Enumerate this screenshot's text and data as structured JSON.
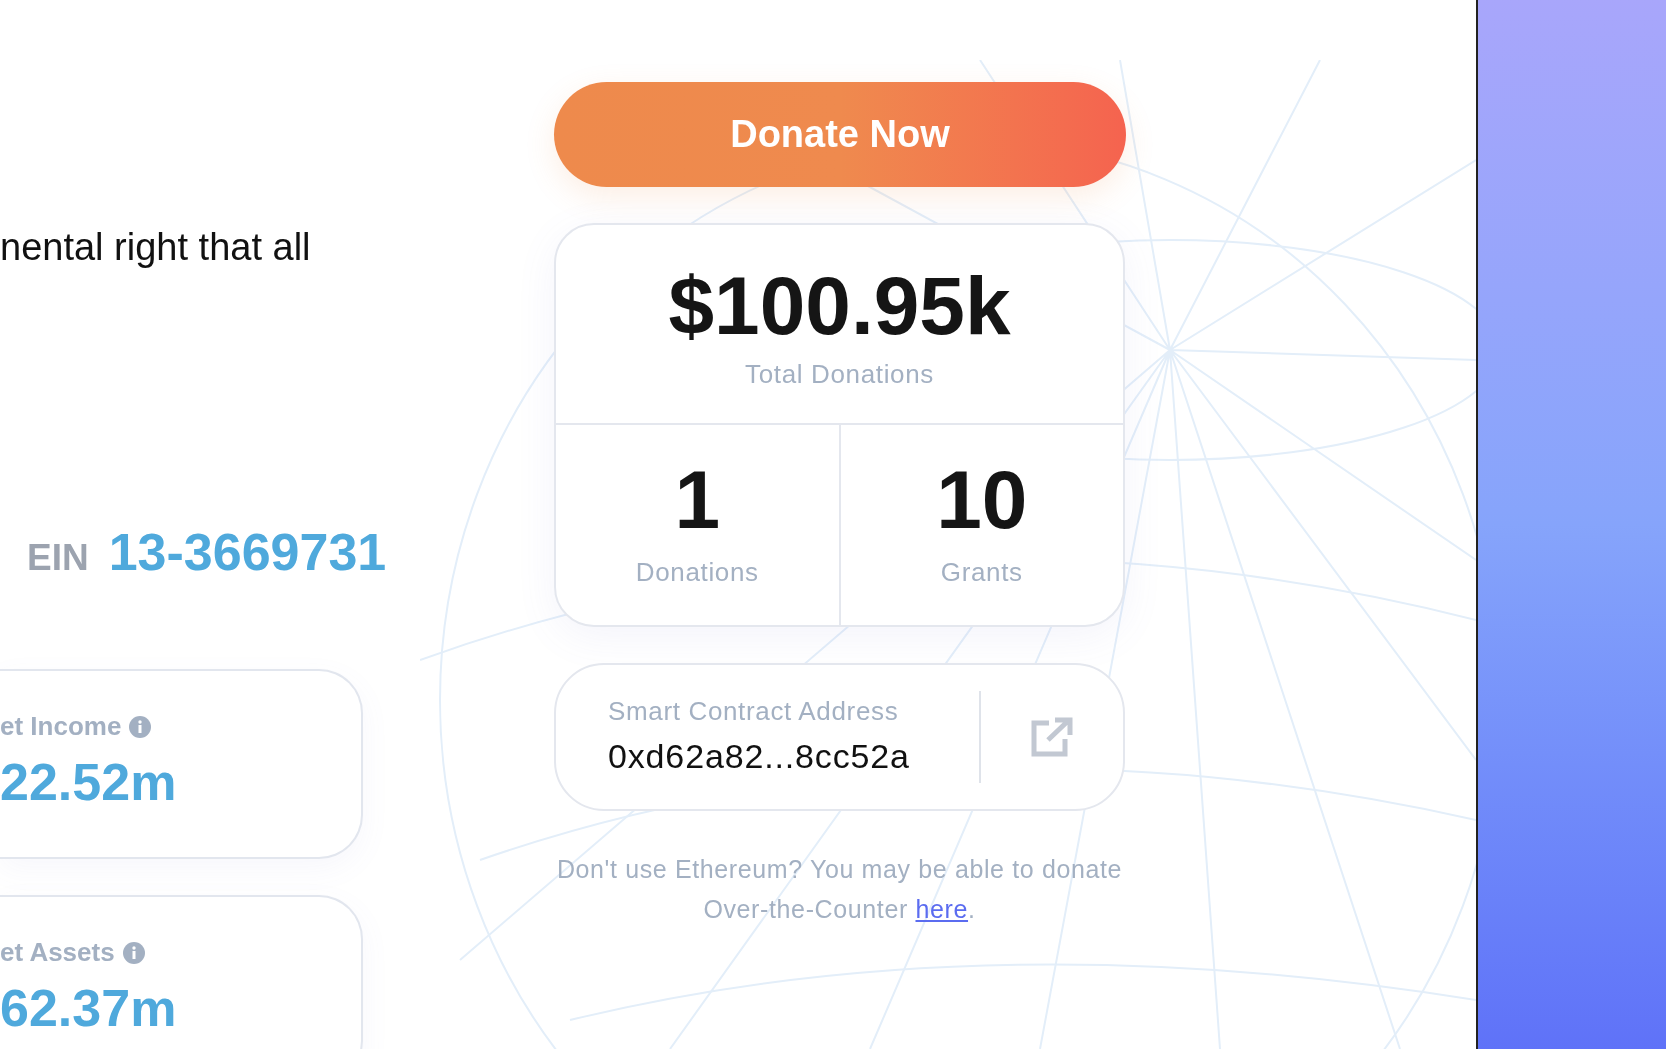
{
  "mission_text": "nental right that all",
  "ein": {
    "label": "EIN",
    "value": "13-3669731"
  },
  "metric_cards": [
    {
      "label": "et Income",
      "value": "22.52m"
    },
    {
      "label": "et Assets",
      "value": "62.37m"
    }
  ],
  "donate_button": "Donate Now",
  "totals": {
    "amount": "$100.95k",
    "label": "Total Donations"
  },
  "counts": [
    {
      "value": "1",
      "label": "Donations"
    },
    {
      "value": "10",
      "label": "Grants"
    }
  ],
  "contract": {
    "label": "Smart Contract Address",
    "address": "0xd62a82...8cc52a"
  },
  "footnote": {
    "text": "Don't use Ethereum? You may be able to donate Over-the-Counter",
    "link": "here",
    "end": "."
  }
}
